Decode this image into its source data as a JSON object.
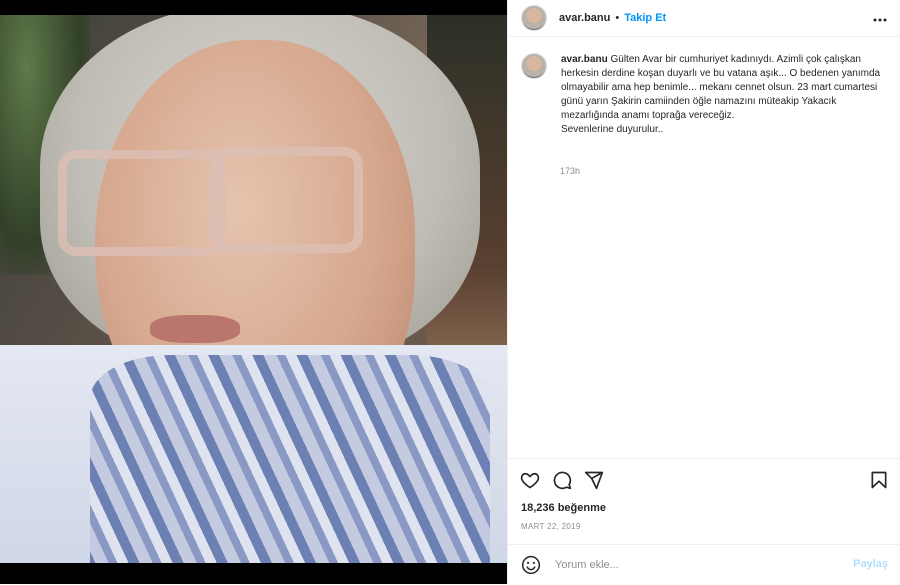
{
  "post": {
    "username": "avar.banu",
    "follow_label": "Takip Et",
    "dot": "•",
    "more_icon": "more-icon",
    "caption_username": "avar.banu",
    "caption_text": "Gülten Avar bir cumhuriyet kadınıydı. Azimli çok çalışkan herkesin derdine koşan duyarlı ve bu vatana aşık... O bedenen yanımda olmayabilir ama hep benimle... mekanı cennet olsun. 23 mart cumartesi günü yarın Şakirin camiinden öğle namazını müteakip Yakacık mezarlığında anamı toprağa vereceğiz.",
    "caption_line2": "Sevenlerine duyurulur..",
    "time_ago": "173h",
    "likes": "18,236 beğenme",
    "date": "MART 22, 2019"
  },
  "comment": {
    "placeholder": "Yorum ekle...",
    "post_label": "Paylaş"
  },
  "colors": {
    "accent": "#0095f6",
    "post_disabled": "#b2dffc",
    "muted": "#8e8e8e"
  }
}
